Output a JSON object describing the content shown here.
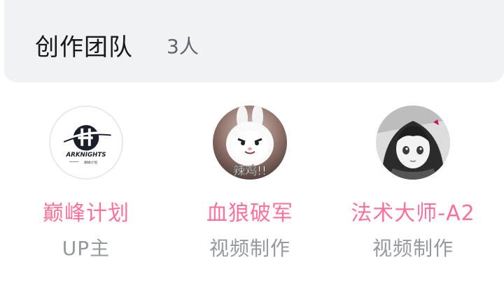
{
  "header": {
    "title": "创作团队",
    "count": "3人"
  },
  "members": [
    {
      "name": "巅峰计划",
      "role": "UP主",
      "avatar": {
        "icon": "arknights-logo-icon",
        "text": "ARKNIGHTS",
        "subtext": "巅峰计划"
      }
    },
    {
      "name": "血狼破军",
      "role": "视频制作",
      "avatar": {
        "icon": "white-rabbit-avatar-icon",
        "text": "辣鸡!!"
      }
    },
    {
      "name": "法术大师-A2",
      "role": "视频制作",
      "avatar": {
        "icon": "anime-girl-avatar-icon"
      }
    }
  ],
  "colors": {
    "name": "#fb7299",
    "role": "#9499a0",
    "header_bg": "#f1f2f3",
    "title": "#18191c"
  }
}
